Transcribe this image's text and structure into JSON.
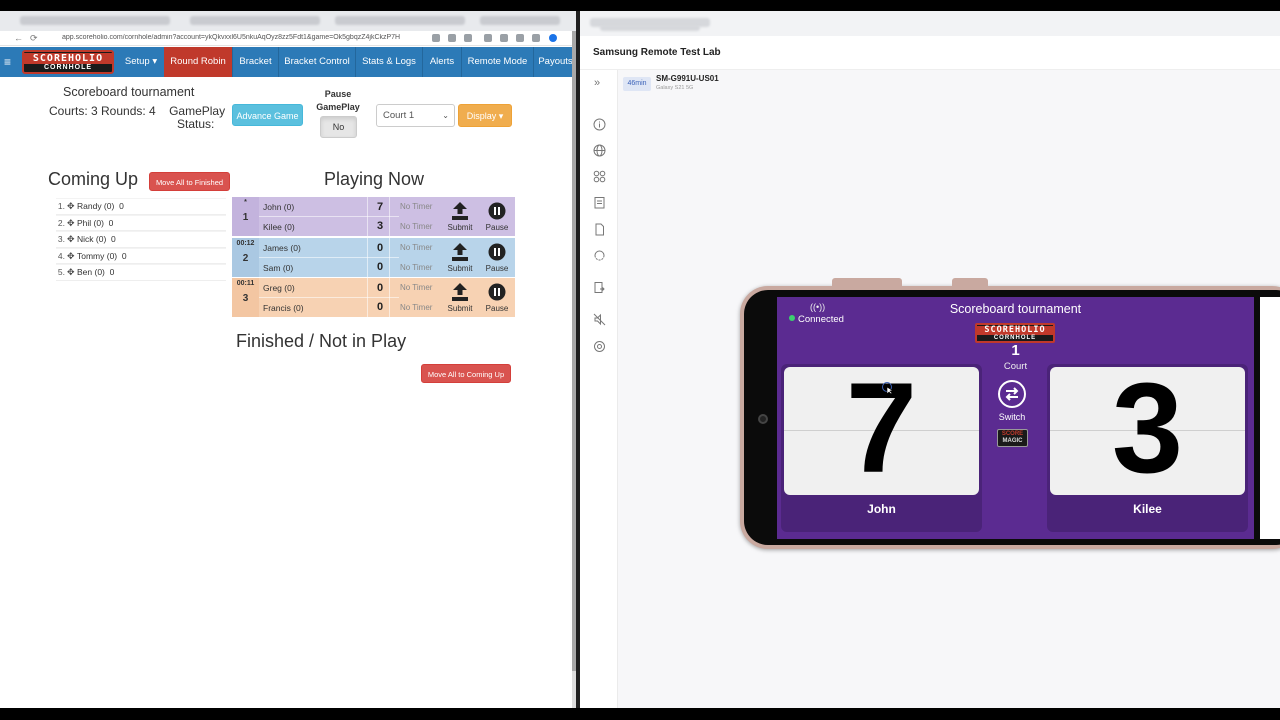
{
  "browser": {
    "url": "app.scoreholio.com/cornhole/admin?account=ykQkvxxl6U5nkuAqOyz8zz5Fdt1&game=Ok5gbqzZ4jkCkzP7H",
    "nav_back": "←",
    "nav_refresh": "⟳"
  },
  "app": {
    "logo_top": "SCOREHOLIO",
    "logo_bottom": "CORNHOLE",
    "menu_icon": "≡",
    "nav": [
      {
        "label": "Setup ▾"
      },
      {
        "label": "Round Robin"
      },
      {
        "label": "Bracket"
      },
      {
        "label": "Bracket Control"
      },
      {
        "label": "Stats & Logs"
      },
      {
        "label": "Alerts"
      },
      {
        "label": "Remote Mode"
      },
      {
        "label": "Payouts"
      }
    ],
    "active_nav": "Round Robin",
    "colors": {
      "nav_bg": "#2c7ab7",
      "active": "#c0392b"
    }
  },
  "scoreboard": {
    "title": "Scoreboard tournament",
    "meta": "Courts: 3 Rounds: 4",
    "gameplay_label": "GamePlay",
    "status_label": "Status:",
    "advance_button": "Advance Game",
    "pause_label_1": "Pause",
    "pause_label_2": "GamePlay",
    "pause_value": "No",
    "court_select": "Court 1",
    "display_button": "Display ▾"
  },
  "coming_up": {
    "heading": "Coming Up",
    "move_button": "Move All to Finished",
    "items": [
      {
        "num": "1.",
        "name": "Randy (0)",
        "val": "0"
      },
      {
        "num": "2.",
        "name": "Phil (0)",
        "val": "0"
      },
      {
        "num": "3.",
        "name": "Nick (0)",
        "val": "0"
      },
      {
        "num": "4.",
        "name": "Tommy (0)",
        "val": "0"
      },
      {
        "num": "5.",
        "name": "Ben (0)",
        "val": "0"
      }
    ]
  },
  "playing_now": {
    "heading": "Playing Now",
    "courts": [
      {
        "timer": "*",
        "court": "1",
        "p1": "John (0)",
        "s1": "7",
        "p2": "Kilee (0)",
        "s2": "3",
        "t1": "No Timer",
        "t2": "No Timer",
        "submit": "Submit",
        "pause": "Pause",
        "color": "#cdbfe3"
      },
      {
        "timer": "00:12",
        "court": "2",
        "p1": "James (0)",
        "s1": "0",
        "p2": "Sam (0)",
        "s2": "0",
        "t1": "No Timer",
        "t2": "No Timer",
        "submit": "Submit",
        "pause": "Pause",
        "color": "#b8d4ea"
      },
      {
        "timer": "00:11",
        "court": "3",
        "p1": "Greg (0)",
        "s1": "0",
        "p2": "Francis (0)",
        "s2": "0",
        "t1": "No Timer",
        "t2": "No Timer",
        "submit": "Submit",
        "pause": "Pause",
        "color": "#f7d2b3"
      }
    ]
  },
  "finished": {
    "heading": "Finished / Not in Play",
    "move_button": "Move All to Coming Up"
  },
  "remote_lab": {
    "title": "Samsung Remote Test Lab",
    "collapse_icon": "»",
    "time_badge": "46min",
    "device_name": "SM-G991U-US01",
    "device_sub": "Galaxy S21 5G",
    "sidebar_icons": [
      "info-icon",
      "globe-icon",
      "apps-icon",
      "clipboard-icon",
      "file-icon",
      "rotate-icon",
      "install-icon",
      "mute-icon",
      "settings-icon"
    ]
  },
  "phone_app": {
    "title": "Scoreboard tournament",
    "connected": "Connected",
    "logo_top": "SCOREHOLIO",
    "logo_bottom": "CORNHOLE",
    "court_number": "1",
    "court_label": "Court",
    "left_score": "7",
    "left_name": "John",
    "right_score": "3",
    "right_name": "Kilee",
    "switch_label": "Switch",
    "magic_top": "SCORE",
    "magic_bottom": "MAGIC",
    "colors": {
      "bg": "#5b2b91",
      "panel": "#4a2378"
    }
  }
}
